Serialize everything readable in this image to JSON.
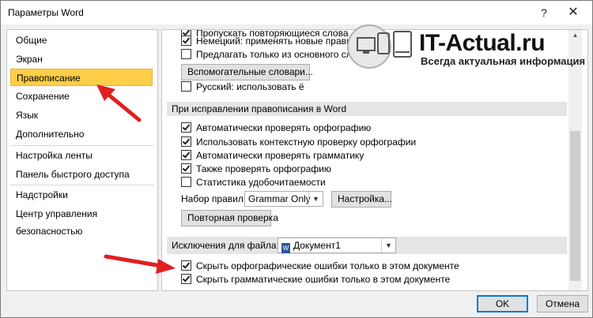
{
  "window": {
    "title": "Параметры Word",
    "help": "?",
    "close": "✕"
  },
  "nav": {
    "items": [
      "Общие",
      "Экран",
      "Правописание",
      "Сохранение",
      "Язык",
      "Дополнительно",
      "Настройка ленты",
      "Панель быстрого доступа",
      "Надстройки",
      "Центр управления безопасностью"
    ],
    "selected": "Правописание"
  },
  "pane": {
    "top_items": [
      {
        "label": "Пропускать повторяющиеся слова",
        "checked": true
      },
      {
        "label": "Немецкий: применять новые правила",
        "checked": true
      },
      {
        "label": "Предлагать только из основного словаря",
        "checked": false
      }
    ],
    "dictionaries_button": "Вспомогательные словари...",
    "russian_item": {
      "label": "Русский: использовать ё",
      "checked": false
    },
    "section_word": "При исправлении правописания в Word",
    "word_items": [
      {
        "label": "Автоматически проверять орфографию",
        "checked": true
      },
      {
        "label": "Использовать контекстную проверку орфографии",
        "checked": true
      },
      {
        "label": "Автоматически проверять грамматику",
        "checked": true
      },
      {
        "label": "Также проверять орфографию",
        "checked": true
      },
      {
        "label": "Статистика удобочитаемости",
        "checked": false
      }
    ],
    "rules_label": "Набор правил:",
    "rules_value": "Grammar Only",
    "settings_button": "Настройка...",
    "recheck_button": "Повторная проверка",
    "exceptions_label": "Исключения для файла:",
    "exceptions_value": "Документ1",
    "exception_items": [
      {
        "label": "Скрыть орфографические ошибки только в этом документе",
        "checked": true
      },
      {
        "label": "Скрыть грамматические ошибки только в этом документе",
        "checked": true
      }
    ]
  },
  "footer": {
    "ok": "OK",
    "cancel": "Отмена"
  },
  "watermark": {
    "name": "IT-Actual.ru",
    "tagline": "Всегда актуальная информация"
  },
  "colors": {
    "selected_bg": "#ffce47",
    "arrow": "#e02020",
    "accent": "#0078d7"
  }
}
